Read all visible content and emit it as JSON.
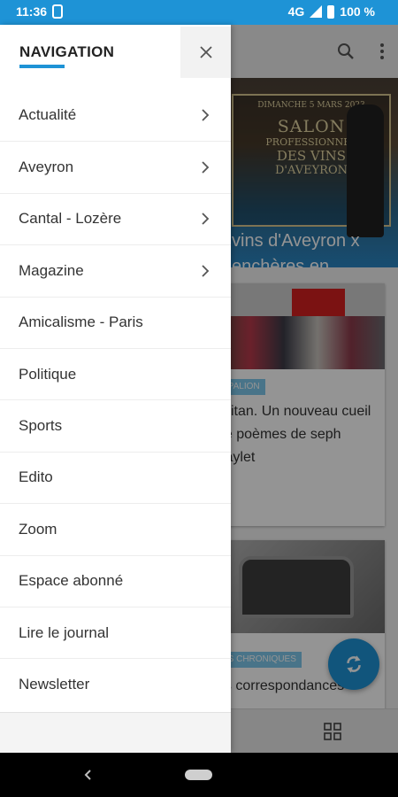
{
  "status_bar": {
    "time": "11:36",
    "network": "4G",
    "battery": "100 %"
  },
  "background": {
    "hero": {
      "poster_date": "DIMANCHE 5 MARS 2023",
      "poster_line1": "SALON",
      "poster_line2": "PROFESSIONNEL",
      "poster_line3": "DES VINS",
      "poster_line4": "D'AVEYRON",
      "title": "vins d'Aveyron x enchères en"
    },
    "cards": [
      {
        "tag": "SPALION",
        "text": "ccitan. Un nouveau cueil de poèmes de seph Vaylet"
      },
      {
        "tag": "ES CHRONIQUES",
        "text": "es correspondances"
      }
    ]
  },
  "drawer": {
    "title": "NAVIGATION",
    "items": [
      {
        "label": "Actualité",
        "has_submenu": true
      },
      {
        "label": "Aveyron",
        "has_submenu": true
      },
      {
        "label": "Cantal - Lozère",
        "has_submenu": true
      },
      {
        "label": "Magazine",
        "has_submenu": true
      },
      {
        "label": "Amicalisme - Paris",
        "has_submenu": false
      },
      {
        "label": "Politique",
        "has_submenu": false
      },
      {
        "label": "Sports",
        "has_submenu": false
      },
      {
        "label": "Edito",
        "has_submenu": false
      },
      {
        "label": "Zoom",
        "has_submenu": false
      },
      {
        "label": "Espace abonné",
        "has_submenu": false
      },
      {
        "label": "Lire le journal",
        "has_submenu": false
      },
      {
        "label": "Newsletter",
        "has_submenu": false
      }
    ]
  },
  "colors": {
    "accent": "#1e93d6",
    "tag": "#7ec9ec"
  }
}
